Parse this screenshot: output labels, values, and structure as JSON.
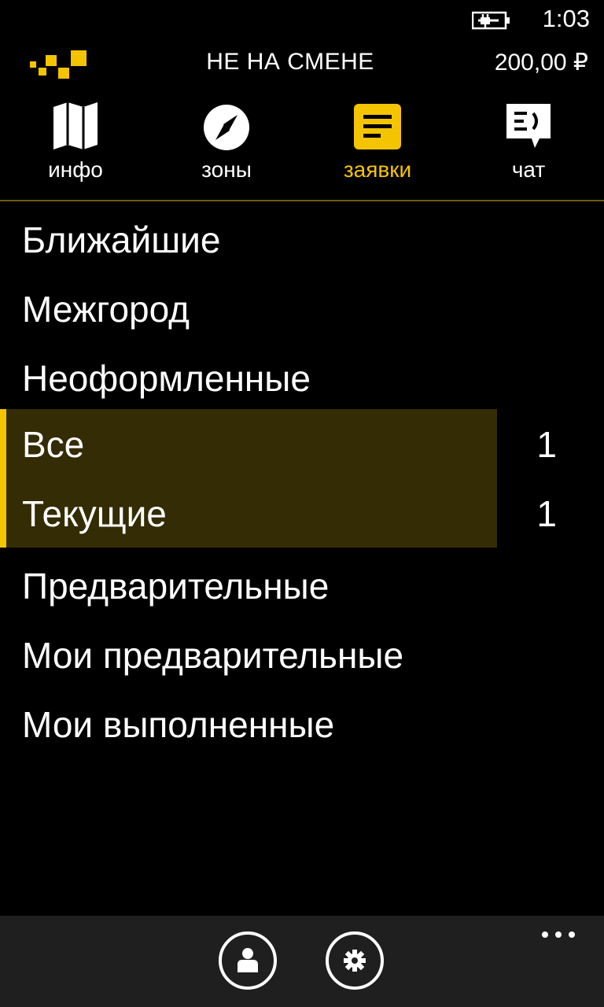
{
  "status_bar": {
    "time": "1:03",
    "battery_icon": "battery-charging-icon"
  },
  "header": {
    "logo_icon": "taxi-checker-logo",
    "shift_status": "НЕ НА СМЕНЕ",
    "balance": "200,00 ₽"
  },
  "tabs": [
    {
      "label": "инфо",
      "icon": "map-icon",
      "active": false
    },
    {
      "label": "зоны",
      "icon": "compass-icon",
      "active": false
    },
    {
      "label": "заявки",
      "icon": "orders-icon",
      "active": true
    },
    {
      "label": "чат",
      "icon": "chat-icon",
      "active": false
    }
  ],
  "colors": {
    "accent": "#f5c400",
    "highlight_bg": "#332c04",
    "background": "#000000",
    "appbar_bg": "#1f1f1f"
  },
  "list": [
    {
      "label": "Ближайшие",
      "count": ""
    },
    {
      "label": "Межгород",
      "count": ""
    },
    {
      "label": "Неоформленные",
      "count": ""
    },
    {
      "label": "Все",
      "count": "1",
      "highlighted": true
    },
    {
      "label": "Текущие",
      "count": "1",
      "highlighted": true
    },
    {
      "label": "Предварительные",
      "count": ""
    },
    {
      "label": "Мои предварительные",
      "count": ""
    },
    {
      "label": "Мои выполненные",
      "count": ""
    }
  ],
  "app_bar": {
    "buttons": [
      {
        "icon": "profile-icon"
      },
      {
        "icon": "settings-icon"
      }
    ],
    "more_icon": "more-dots-icon"
  }
}
